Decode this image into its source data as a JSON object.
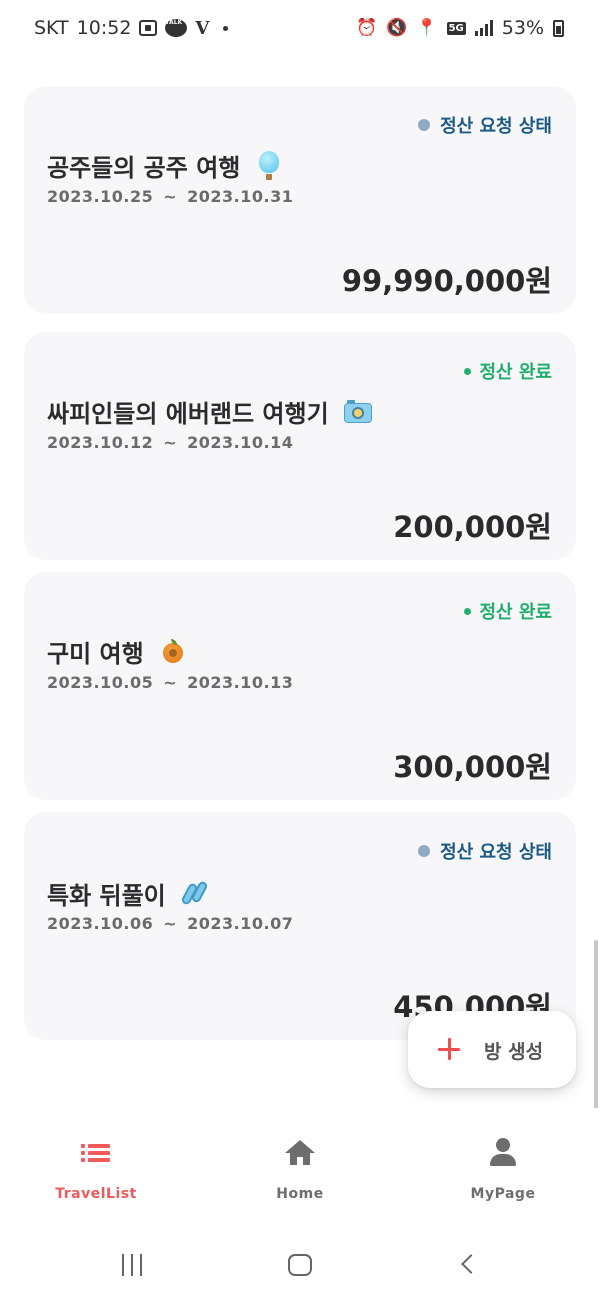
{
  "status_bar": {
    "carrier": "SKT",
    "time": "10:52",
    "talk_label": "TALK",
    "v_label": "V",
    "network": "5G",
    "battery": "53%"
  },
  "trips": [
    {
      "status": "정산 요청 상태",
      "status_type": "requested",
      "title": "공주들의 공주 여행",
      "emoji": "hot-air-balloon-icon",
      "start_date": "2023.10.25",
      "date_separator": "~",
      "end_date": "2023.10.31",
      "amount": "99,990,000원"
    },
    {
      "status": "정산 완료",
      "status_type": "completed",
      "title": "싸피인들의 에버랜드 여행기",
      "emoji": "camera-icon",
      "start_date": "2023.10.12",
      "date_separator": "~",
      "end_date": "2023.10.14",
      "amount": "200,000원"
    },
    {
      "status": "정산 완료",
      "status_type": "completed",
      "title": "구미 여행",
      "emoji": "orange-icon",
      "start_date": "2023.10.05",
      "date_separator": "~",
      "end_date": "2023.10.13",
      "amount": "300,000원"
    },
    {
      "status": "정산 요청 상태",
      "status_type": "requested",
      "title": "특화 뒤풀이",
      "emoji": "sandals-icon",
      "start_date": "2023.10.06",
      "date_separator": "~",
      "end_date": "2023.10.07",
      "amount": "450,000원"
    }
  ],
  "fab": {
    "label": "방 생성",
    "icon": "plus-icon"
  },
  "bottom_nav": {
    "active": "TravelList",
    "items": [
      {
        "label": "TravelList",
        "icon": "list-icon"
      },
      {
        "label": "Home",
        "icon": "home-icon"
      },
      {
        "label": "MyPage",
        "icon": "person-icon"
      }
    ]
  },
  "colors": {
    "accent": "#ef5a5a",
    "status_requested": "#1c5a86",
    "status_completed": "#1fae6b",
    "card_background": "#f7f7f9"
  }
}
